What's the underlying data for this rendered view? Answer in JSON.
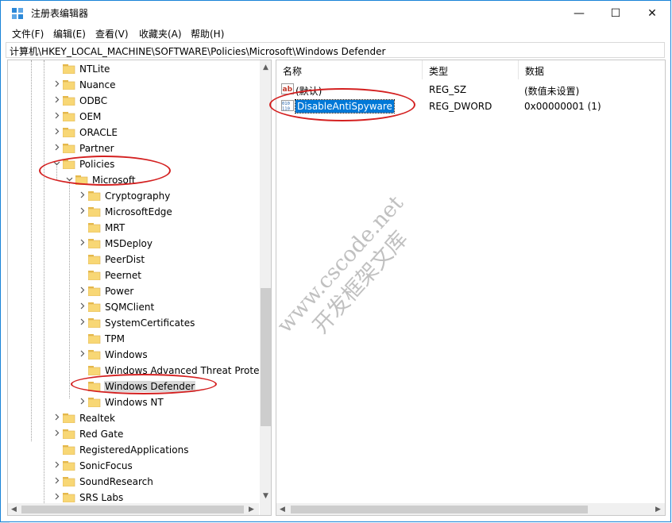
{
  "window": {
    "title": "注册表编辑器",
    "controls": {
      "minimize": "—",
      "maximize": "☐",
      "close": "✕"
    }
  },
  "menu": [
    "文件(F)",
    "编辑(E)",
    "查看(V)",
    "收藏夹(A)",
    "帮助(H)"
  ],
  "address": "计算机\\HKEY_LOCAL_MACHINE\\SOFTWARE\\Policies\\Microsoft\\Windows Defender",
  "tree": [
    {
      "label": "NTLite",
      "level": 0,
      "expander": "none"
    },
    {
      "label": "Nuance",
      "level": 0,
      "expander": "collapsed"
    },
    {
      "label": "ODBC",
      "level": 0,
      "expander": "collapsed"
    },
    {
      "label": "OEM",
      "level": 0,
      "expander": "collapsed"
    },
    {
      "label": "ORACLE",
      "level": 0,
      "expander": "collapsed"
    },
    {
      "label": "Partner",
      "level": 0,
      "expander": "collapsed"
    },
    {
      "label": "Policies",
      "level": 0,
      "expander": "expanded"
    },
    {
      "label": "Microsoft",
      "level": 1,
      "expander": "expanded"
    },
    {
      "label": "Cryptography",
      "level": 2,
      "expander": "collapsed"
    },
    {
      "label": "MicrosoftEdge",
      "level": 2,
      "expander": "collapsed"
    },
    {
      "label": "MRT",
      "level": 2,
      "expander": "none"
    },
    {
      "label": "MSDeploy",
      "level": 2,
      "expander": "collapsed"
    },
    {
      "label": "PeerDist",
      "level": 2,
      "expander": "none"
    },
    {
      "label": "Peernet",
      "level": 2,
      "expander": "none"
    },
    {
      "label": "Power",
      "level": 2,
      "expander": "collapsed"
    },
    {
      "label": "SQMClient",
      "level": 2,
      "expander": "collapsed"
    },
    {
      "label": "SystemCertificates",
      "level": 2,
      "expander": "collapsed"
    },
    {
      "label": "TPM",
      "level": 2,
      "expander": "none"
    },
    {
      "label": "Windows",
      "level": 2,
      "expander": "collapsed"
    },
    {
      "label": "Windows Advanced Threat Protection",
      "level": 2,
      "expander": "none"
    },
    {
      "label": "Windows Defender",
      "level": 2,
      "expander": "none",
      "selected": true
    },
    {
      "label": "Windows NT",
      "level": 2,
      "expander": "collapsed"
    },
    {
      "label": "Realtek",
      "level": 0,
      "expander": "collapsed"
    },
    {
      "label": "Red Gate",
      "level": 0,
      "expander": "collapsed"
    },
    {
      "label": "RegisteredApplications",
      "level": 0,
      "expander": "none"
    },
    {
      "label": "SonicFocus",
      "level": 0,
      "expander": "collapsed"
    },
    {
      "label": "SoundResearch",
      "level": 0,
      "expander": "collapsed"
    },
    {
      "label": "SRS Labs",
      "level": 0,
      "expander": "collapsed"
    }
  ],
  "columns": [
    "名称",
    "类型",
    "数据"
  ],
  "values": [
    {
      "name": "(默认)",
      "type": "REG_SZ",
      "data": "(数值未设置)",
      "icon": "string-value-icon"
    },
    {
      "name": "DisableAntiSpyware",
      "type": "REG_DWORD",
      "data": "0x00000001 (1)",
      "icon": "binary-value-icon",
      "selected": true
    }
  ],
  "watermark": [
    "www.cscode.net",
    "开发框架文库"
  ],
  "colors": {
    "accent": "#0078d7",
    "folder": "#f8d775",
    "annotation": "#d42020"
  }
}
